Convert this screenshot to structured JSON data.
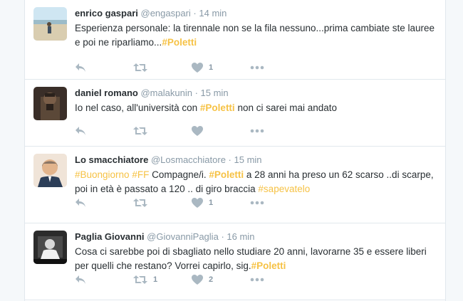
{
  "tweets": [
    {
      "name": "enrico gaspari",
      "handle": "@engaspari",
      "time": "14 min",
      "text": [
        "Esperienza personale: la tirennale non se la fila nessuno...prima cambiate ste lauree e poi ne riparliamo...",
        "#Poletti"
      ],
      "likes": "1",
      "retweets": ""
    },
    {
      "name": "daniel romano",
      "handle": "@malakunin",
      "time": "15 min",
      "text": [
        "Io nel caso, all'università con ",
        "#Poletti",
        " non ci sarei mai andato"
      ],
      "likes": "",
      "retweets": ""
    },
    {
      "name": "Lo smacchiatore",
      "handle": "@Losmacchiatore",
      "time": "15 min",
      "text": [
        "#Buongiorno",
        " ",
        "#FF",
        " Compagne/i. ",
        "#Poletti",
        " a 28 anni ha preso un 62 scarso ..di scarpe, poi in età è passato a 120 .. di giro braccia ",
        "#sapevatelo"
      ],
      "likes": "1",
      "retweets": ""
    },
    {
      "name": "Paglia Giovanni",
      "handle": "@GiovanniPaglia",
      "time": "16 min",
      "text": [
        "Cosa ci sarebbe poi di sbagliato nello studiare 20 anni, lavorarne 35 e essere liberi per quelli che restano? Vorrei capirlo, sig.",
        "#Poletti"
      ],
      "likes": "2",
      "retweets": "1"
    }
  ],
  "separator": "·",
  "colors": {
    "hashtag": "#f6c245",
    "muted": "#8899a6",
    "border": "#e1e8ed"
  },
  "icons": [
    "reply-icon",
    "retweet-icon",
    "heart-icon",
    "more-icon"
  ]
}
